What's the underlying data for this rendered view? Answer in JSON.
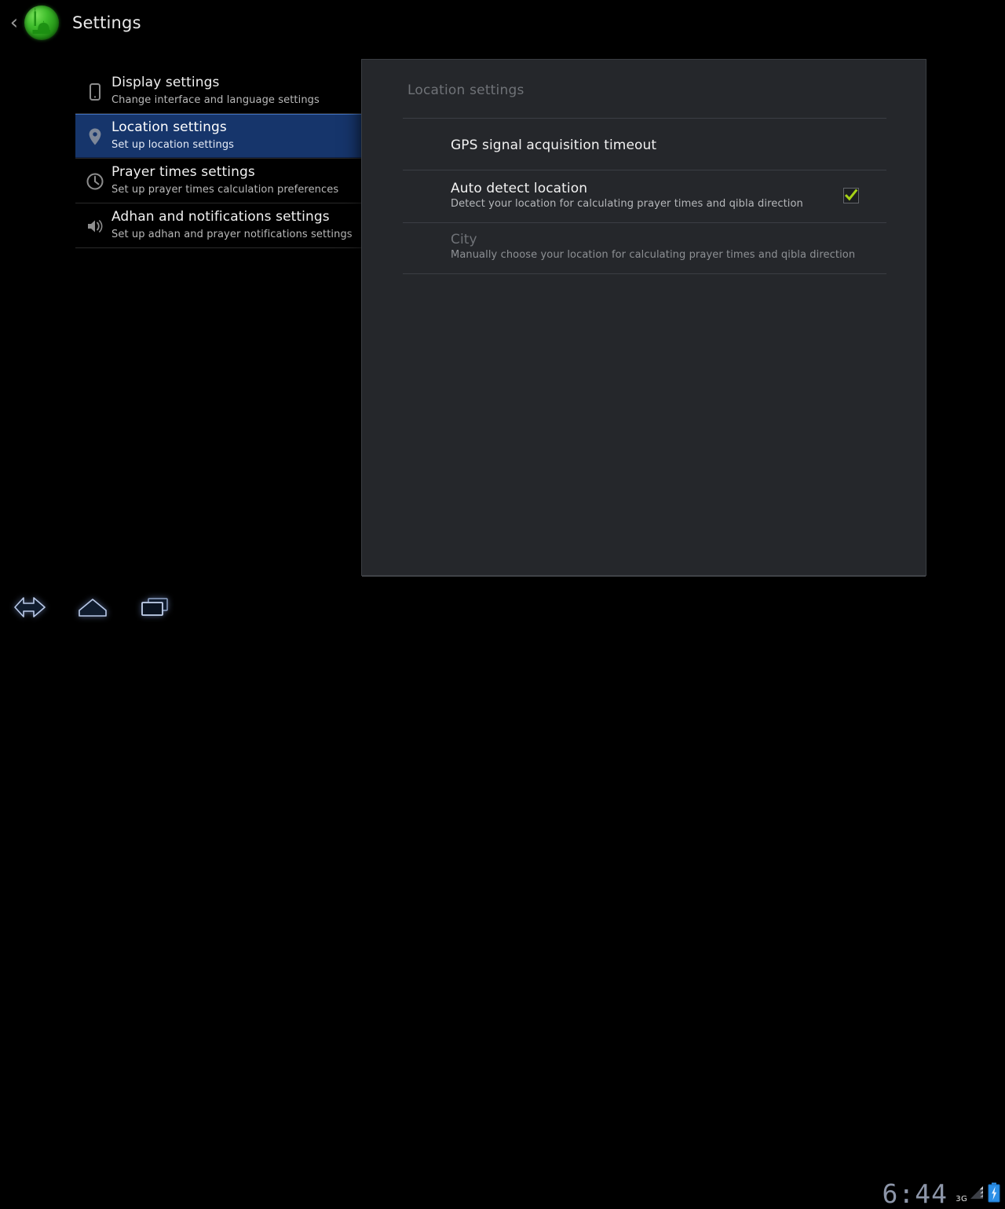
{
  "appbar": {
    "back_icon": "back-chevron-icon",
    "app_icon": "mosque-app-icon",
    "title": "Settings"
  },
  "sidebar": {
    "items": [
      {
        "icon": "device-phone-icon",
        "title": "Display settings",
        "summary": "Change interface and language settings",
        "selected": false
      },
      {
        "icon": "location-pin-icon",
        "title": "Location settings",
        "summary": "Set up location settings",
        "selected": true
      },
      {
        "icon": "clock-icon",
        "title": "Prayer times settings",
        "summary": "Set up prayer times calculation preferences",
        "selected": false
      },
      {
        "icon": "speaker-icon",
        "title": "Adhan and notifications settings",
        "summary": "Set up adhan and prayer notifications settings",
        "selected": false
      }
    ]
  },
  "dialog": {
    "title": "Location settings",
    "preferences": [
      {
        "title": "GPS signal acquisition timeout",
        "summary": "",
        "disabled": false,
        "has_checkbox": false
      },
      {
        "title": "Auto detect location",
        "summary": "Detect your location for calculating prayer times and qibla direction",
        "disabled": false,
        "has_checkbox": true,
        "checked": true
      },
      {
        "title": "City",
        "summary": "Manually choose your location for calculating prayer times and qibla direction",
        "disabled": true,
        "has_checkbox": false
      }
    ]
  },
  "systembar": {
    "nav": [
      {
        "icon": "back-icon",
        "label": "Back"
      },
      {
        "icon": "home-icon",
        "label": "Home"
      },
      {
        "icon": "recents-icon",
        "label": "Recent apps"
      }
    ],
    "clock": "6:44",
    "network": "3G",
    "signal_icon": "signal-bars-icon",
    "battery_icon": "battery-charging-icon"
  },
  "colors": {
    "background": "#000000",
    "dialog_bg": "#25272b",
    "selected_row": "#16356b",
    "selected_row_top_border": "#3f6fbd",
    "accent_check": "#a6d217",
    "app_icon_green": "#3fbd2c",
    "battery_blue": "#2b8fe8",
    "clock_blue_gray": "#8d96a9",
    "muted_text": "#6f7277"
  }
}
